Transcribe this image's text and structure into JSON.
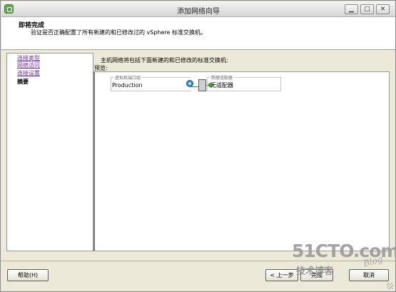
{
  "window": {
    "title": "添加网络向导"
  },
  "header": {
    "title": "即将完成",
    "description": "验证是否正确配置了所有新建的和已修改过的 vSphere 标准交换机。"
  },
  "sidebar": {
    "items": [
      {
        "label": "连接类型",
        "state": "link"
      },
      {
        "label": "网络访问",
        "state": "link"
      },
      {
        "label": "连接设置",
        "state": "link"
      },
      {
        "label": "摘要",
        "state": "current"
      }
    ]
  },
  "content": {
    "intro": "主机网络将包括下面新建的和已修改的标准交换机:",
    "preview_label": "预览:",
    "diagram": {
      "vm_group_label": "虚拟机端口组",
      "vm_port_name": "Production",
      "physical_group_label": "物理适配器",
      "physical_value": "无适配器"
    }
  },
  "buttons": {
    "help": "帮助(H)",
    "back": "< 上一步",
    "finish": "完成",
    "cancel": "取消"
  },
  "watermark": {
    "main": "51CTO.com",
    "sub": "技术博客",
    "blog": "Blog"
  },
  "icons": {
    "app": "vmware-wizard-icon",
    "vm_port": "vm-port-group-icon",
    "switch": "virtual-switch-icon",
    "nic": "physical-nic-icon"
  },
  "colors": {
    "link": "#6b2fa6",
    "dialog_bg": "#ece9d8",
    "connector_green": "#3a8a2a"
  }
}
